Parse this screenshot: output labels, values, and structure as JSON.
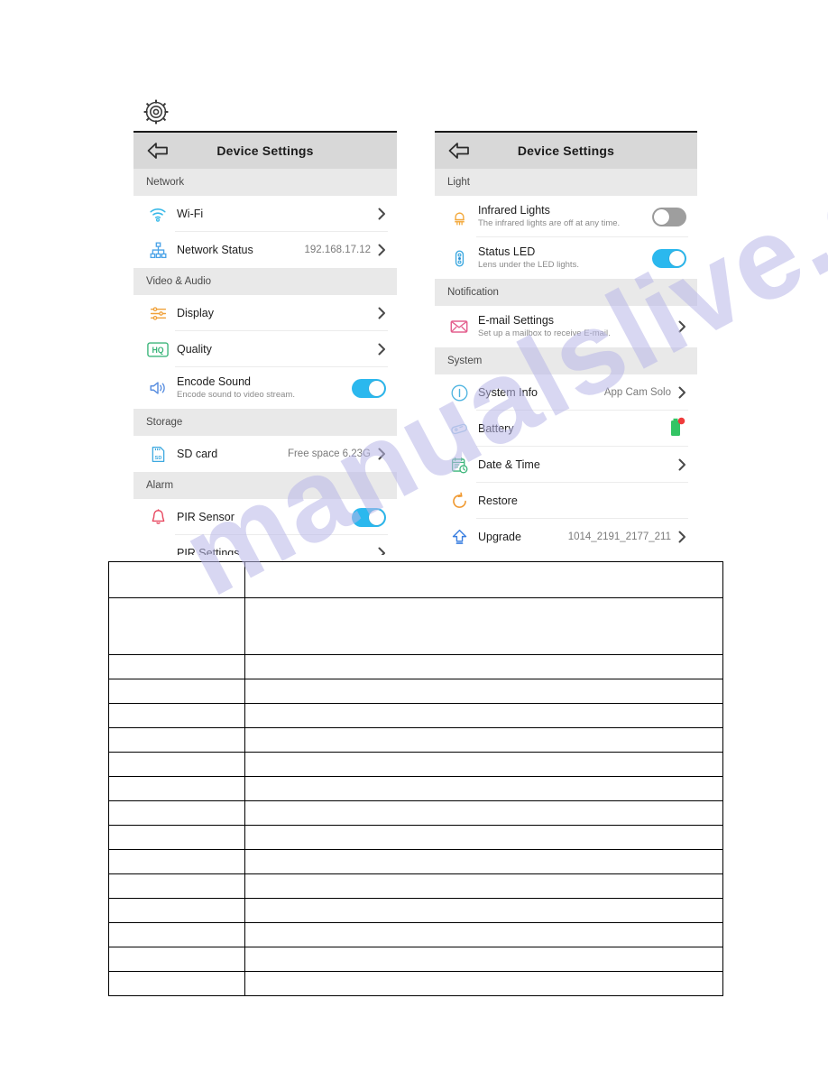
{
  "document": {
    "watermark": "manualslive.com",
    "top_icon": "gear-icon"
  },
  "panel_left": {
    "nav": {
      "back_icon": "back-arrow-icon",
      "title": "Device Settings"
    },
    "sections": [
      {
        "heading": "Network",
        "rows": [
          {
            "icon": "wifi-icon",
            "label": "Wi-Fi",
            "sub": "",
            "value": "",
            "control": "chevron"
          },
          {
            "icon": "network-status-icon",
            "label": "Network Status",
            "sub": "",
            "value": "192.168.17.12",
            "control": "chevron"
          }
        ]
      },
      {
        "heading": "Video & Audio",
        "rows": [
          {
            "icon": "display-sliders-icon",
            "label": "Display",
            "sub": "",
            "value": "",
            "control": "chevron"
          },
          {
            "icon": "hq-badge-icon",
            "label": "Quality",
            "sub": "",
            "value": "",
            "control": "chevron"
          },
          {
            "icon": "speaker-icon",
            "label": "Encode Sound",
            "sub": "Encode sound to video stream.",
            "value": "",
            "control": "toggle-on"
          }
        ]
      },
      {
        "heading": "Storage",
        "rows": [
          {
            "icon": "sd-card-icon",
            "label": "SD card",
            "sub": "",
            "value": "Free space 6.23G",
            "control": "chevron"
          }
        ]
      },
      {
        "heading": "Alarm",
        "rows": [
          {
            "icon": "bell-icon",
            "label": "PIR Sensor",
            "sub": "",
            "value": "",
            "control": "toggle-on"
          },
          {
            "icon": "",
            "label": "PIR Settings",
            "sub": "",
            "value": "",
            "control": "chevron"
          }
        ]
      }
    ]
  },
  "panel_right": {
    "nav": {
      "back_icon": "back-arrow-icon",
      "title": "Device Settings"
    },
    "sections": [
      {
        "heading": "Light",
        "rows": [
          {
            "icon": "infrared-led-icon",
            "label": "Infrared Lights",
            "sub": "The infrared lights are off at any time.",
            "value": "",
            "control": "toggle-off"
          },
          {
            "icon": "status-led-icon",
            "label": "Status LED",
            "sub": "Lens under the LED lights.",
            "value": "",
            "control": "toggle-on"
          }
        ]
      },
      {
        "heading": "Notification",
        "rows": [
          {
            "icon": "envelope-icon",
            "label": "E-mail Settings",
            "sub": "Set up a mailbox to receive E-mail.",
            "value": "",
            "control": "chevron"
          }
        ]
      },
      {
        "heading": "System",
        "rows": [
          {
            "icon": "info-icon",
            "label": "System Info",
            "sub": "",
            "value": "App Cam Solo",
            "control": "chevron"
          },
          {
            "icon": "battery-tag-icon",
            "label": "Battery",
            "sub": "",
            "value": "",
            "control": "battery"
          },
          {
            "icon": "calendar-clock-icon",
            "label": "Date & Time",
            "sub": "",
            "value": "",
            "control": "chevron"
          },
          {
            "icon": "restore-icon",
            "label": "Restore",
            "sub": "",
            "value": "",
            "control": "none"
          },
          {
            "icon": "upgrade-arrow-icon",
            "label": "Upgrade",
            "sub": "",
            "value": "1014_2191_2177_211",
            "control": "chevron"
          }
        ]
      }
    ]
  },
  "blank_table": {
    "column_count": 2,
    "row_count": 16,
    "cells": []
  },
  "colors": {
    "accent_toggle_on": "#2bb8ee",
    "toggle_off": "#9e9e9e",
    "nav_bar": "#d8d8d8",
    "section_head": "#e9e9e9",
    "watermark": "#b9b7e8"
  }
}
